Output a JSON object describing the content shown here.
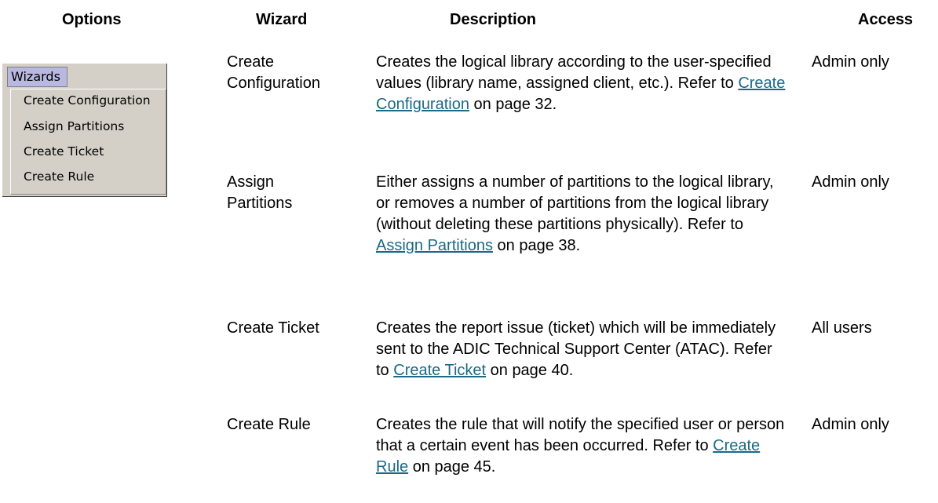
{
  "headers": {
    "options": "Options",
    "wizard": "Wizard",
    "description": "Description",
    "access": "Access"
  },
  "menu": {
    "bar_label": "Wizards",
    "items": [
      "Create Configuration",
      "Assign Partitions",
      "Create Ticket",
      "Create Rule"
    ]
  },
  "rows": [
    {
      "wizard_line1": "Create",
      "wizard_line2": "Configuration",
      "desc_before": "Creates the logical library according to the user-specified values (library name, assigned client, etc.). Refer to ",
      "link": "Create Configuration",
      "desc_after": " on page 32.",
      "access": "Admin only"
    },
    {
      "wizard_line1": "Assign",
      "wizard_line2": "Partitions",
      "desc_before": "Either assigns a number of partitions to the logical library, or removes a number of partitions from the logical library (without deleting these partitions physically). Refer to ",
      "link": "Assign Partitions",
      "desc_after": " on page 38.",
      "access": "Admin only"
    },
    {
      "wizard_line1": "Create Ticket",
      "wizard_line2": "",
      "desc_before": "Creates the report issue (ticket) which will be immediately sent to the ADIC Technical Support Center (ATAC). Refer to ",
      "link": "Create Ticket",
      "desc_after": " on page 40.",
      "access": "All users"
    },
    {
      "wizard_line1": "Create Rule",
      "wizard_line2": "",
      "desc_before": "Creates the rule that will notify the specified user or person that a certain event has been occurred. Refer to ",
      "link": "Create Rule",
      "desc_after": " on page 45.",
      "access": "Admin only"
    }
  ],
  "colors": {
    "link": "#1a6a86",
    "menu_background": "#d4d0c8",
    "menu_tab_highlight": "#b8b8e0"
  }
}
